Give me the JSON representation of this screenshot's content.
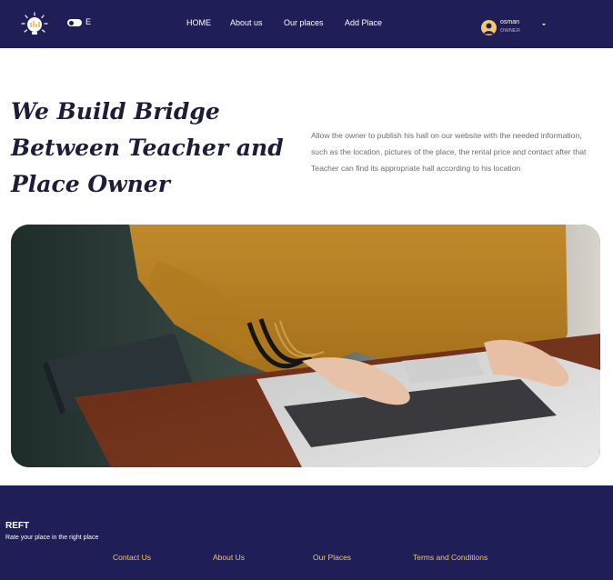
{
  "nav": {
    "toggle_label": "E",
    "links": [
      "HOME",
      "About us",
      "Our places",
      "Add Place"
    ],
    "user": {
      "name": "osman",
      "role": "OWNER"
    },
    "logo_icon": "lightbulb-logo-icon",
    "avatar_icon": "user-avatar-icon",
    "dropdown_icon": "caret-down-icon"
  },
  "hero": {
    "title_lines": [
      "We Build Bridge",
      "Between Teacher and",
      "Place Owner"
    ],
    "description": "Allow the owner to publish his hall on our website with the needed information, such as the location, pictures of the place, the rental price and contact after that Teacher can find its appropriate hall according to his location"
  },
  "photo": {
    "icon": "hands-typing-laptop-photo"
  },
  "footer": {
    "brand": "REFT",
    "tagline": "Rate your place in the right place",
    "links": [
      "Contact Us",
      "About Us",
      "Our Places",
      "Terms and Conditions"
    ]
  },
  "colors": {
    "navy": "#1f1e56",
    "accent": "#f2c66b",
    "title": "#1d1d3a",
    "body_text": "#6b6b78"
  }
}
